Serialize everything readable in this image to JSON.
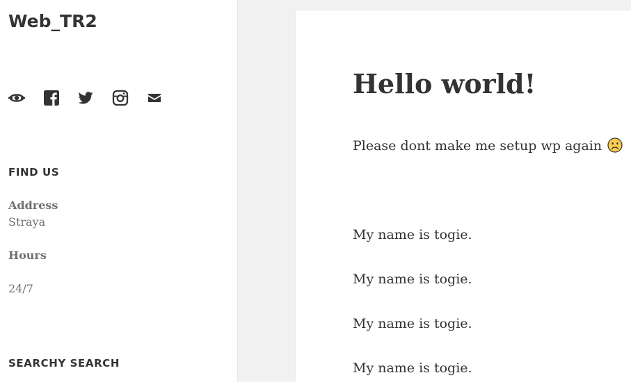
{
  "site": {
    "title": "Web_TR2"
  },
  "social_links": [
    {
      "icon": "wordpress-icon"
    },
    {
      "icon": "facebook-icon"
    },
    {
      "icon": "twitter-icon"
    },
    {
      "icon": "instagram-icon"
    },
    {
      "icon": "email-icon"
    }
  ],
  "widgets": {
    "find_us": {
      "title": "FIND US",
      "address_label": "Address",
      "address_value": "Straya",
      "hours_label": "Hours",
      "hours_value": "24/7"
    },
    "search": {
      "title": "SEARCHY SEARCH"
    }
  },
  "post": {
    "title": "Hello world!",
    "intro": "Please dont make me setup wp again",
    "intro_emoji": "frowning-face-icon",
    "lines": [
      "My name is togie.",
      "My name is togie.",
      "My name is togie.",
      "My name is togie."
    ]
  },
  "colors": {
    "page_background": "#f1f1f1",
    "text": "#333333",
    "muted_text": "#707070",
    "emoji_fill": "#ffcc4d"
  }
}
